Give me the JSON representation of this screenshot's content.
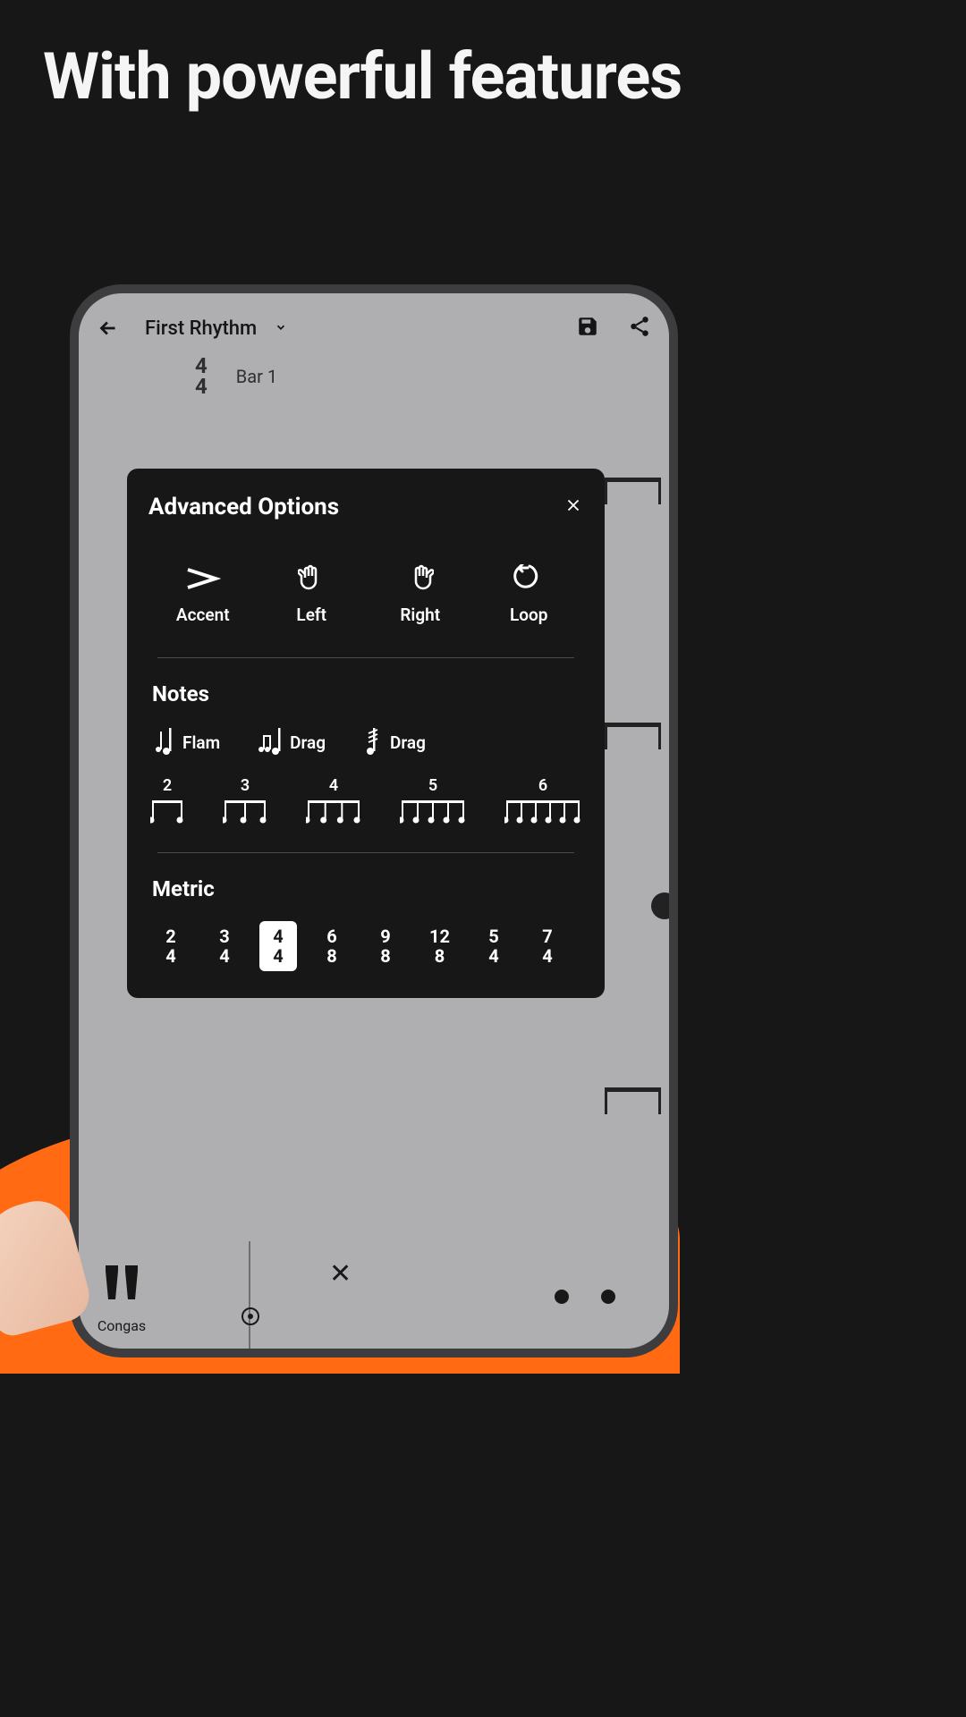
{
  "headline": "With powerful features",
  "app": {
    "title": "First Rhythm",
    "time_sig_top": "4",
    "time_sig_bottom": "4",
    "bar_label": "Bar 1",
    "instrument_label": "Congas"
  },
  "modal": {
    "title": "Advanced Options",
    "options": [
      {
        "label": "Accent"
      },
      {
        "label": "Left"
      },
      {
        "label": "Right"
      },
      {
        "label": "Loop"
      }
    ],
    "notes_title": "Notes",
    "notes": [
      {
        "label": "Flam"
      },
      {
        "label": "Drag"
      },
      {
        "label": "Drag"
      }
    ],
    "tuplets": [
      "2",
      "3",
      "4",
      "5",
      "6"
    ],
    "metric_title": "Metric",
    "metrics": [
      {
        "top": "2",
        "bottom": "4",
        "selected": false
      },
      {
        "top": "3",
        "bottom": "4",
        "selected": false
      },
      {
        "top": "4",
        "bottom": "4",
        "selected": true
      },
      {
        "top": "6",
        "bottom": "8",
        "selected": false
      },
      {
        "top": "9",
        "bottom": "8",
        "selected": false
      },
      {
        "top": "12",
        "bottom": "8",
        "selected": false
      },
      {
        "top": "5",
        "bottom": "4",
        "selected": false
      },
      {
        "top": "7",
        "bottom": "4",
        "selected": false
      }
    ]
  }
}
